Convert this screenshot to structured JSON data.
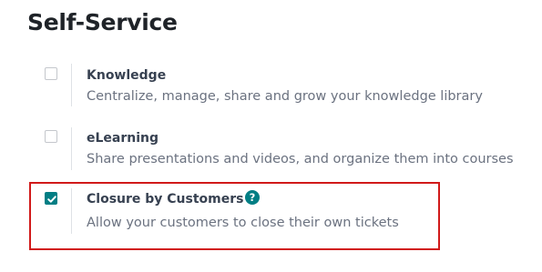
{
  "section": {
    "title": "Self-Service"
  },
  "settings": [
    {
      "label": "Knowledge",
      "description": "Centralize, manage, share and grow your knowledge library",
      "checked": false
    },
    {
      "label": "eLearning",
      "description": "Share presentations and videos, and organize them into courses",
      "checked": false
    },
    {
      "label": "Closure by Customers",
      "description": "Allow your customers to close their own tickets",
      "checked": true,
      "help_icon": "question-circle-icon"
    }
  ],
  "colors": {
    "accent": "#017e84",
    "highlight_border": "#d11a1a",
    "title": "#1f2328",
    "label": "#374151",
    "description": "#6b7280"
  }
}
